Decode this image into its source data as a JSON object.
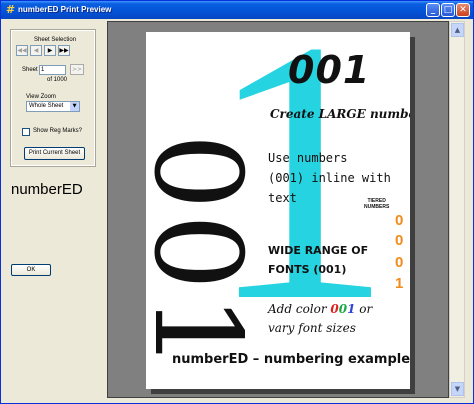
{
  "window": {
    "title": "numberED Print Preview",
    "icon": "#",
    "minimize": "_",
    "maximize": "□",
    "close": "✕"
  },
  "sheet_selection": {
    "label": "Sheet Selection",
    "buttons": {
      "first": "◀◀",
      "prev": "◀",
      "next": "▶",
      "last": "▶▶"
    },
    "sheet_label": "Sheet",
    "sheet_value": "1",
    "goto_label": ">>",
    "of_label": "of 1000"
  },
  "view_zoom": {
    "label": "View Zoom",
    "selected": "Whole Sheet",
    "arrow": "▼"
  },
  "reg_marks": {
    "label": "Show Reg Marks?",
    "checked": false
  },
  "print_button": "Print Current Sheet",
  "app_name": "numberED",
  "ok_button": "OK",
  "scrollbar": {
    "up": "▲",
    "down": "▼"
  },
  "sheet": {
    "big_vertical": "001",
    "big_one": "1",
    "top_number": "001",
    "create_prefix": "Create ",
    "create_bold": "LARGE",
    "create_suffix": " numbers",
    "use_line1": "Use numbers",
    "use_line2": "(001) inline with",
    "use_line3": "text",
    "tiered_line1": "TIERED",
    "tiered_line2": "NUMBERS",
    "tiered_digits": [
      "0",
      "0",
      "0",
      "1"
    ],
    "wide_line1": "WIDE RANGE OF",
    "wide_line2": "FONTS (001)",
    "color_prefix": "Add color ",
    "color_digit1": "0",
    "color_digit2": "0",
    "color_digit3": "1",
    "color_suffix": " or",
    "vary_line": "vary font sizes",
    "footer": "numberED – numbering examples"
  }
}
